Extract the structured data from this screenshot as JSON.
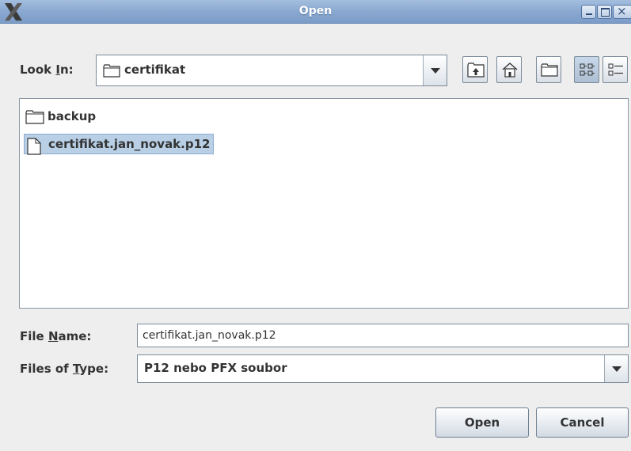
{
  "window": {
    "title": "Open",
    "app_icon": "x-logo-icon",
    "controls": [
      "minimize-icon",
      "maximize-icon",
      "close-icon"
    ]
  },
  "look_in": {
    "label_before": "Look ",
    "label_mnemonic": "I",
    "label_after": "n:",
    "value": "certifikat",
    "value_icon": "folder-icon"
  },
  "toolbar": {
    "buttons": [
      "up-one-level-icon",
      "home-icon",
      "new-folder-icon",
      "list-view-icon",
      "details-view-icon"
    ],
    "active": "list-view-icon"
  },
  "files": [
    {
      "name": "backup",
      "icon": "folder-icon",
      "selected": false
    },
    {
      "name": "certifikat.jan_novak.p12",
      "icon": "file-icon",
      "selected": true
    }
  ],
  "file_name": {
    "label_before": "File ",
    "label_mnemonic": "N",
    "label_after": "ame:",
    "value": "certifikat.jan_novak.p12"
  },
  "file_type": {
    "label_before": "Files of ",
    "label_mnemonic": "T",
    "label_after": "ype:",
    "value": "P12 nebo PFX soubor"
  },
  "buttons": {
    "open": "Open",
    "cancel": "Cancel"
  },
  "colors": {
    "titlebar": "#8aa9d0",
    "selection": "#b8cfe5",
    "background": "#eeeeee"
  }
}
